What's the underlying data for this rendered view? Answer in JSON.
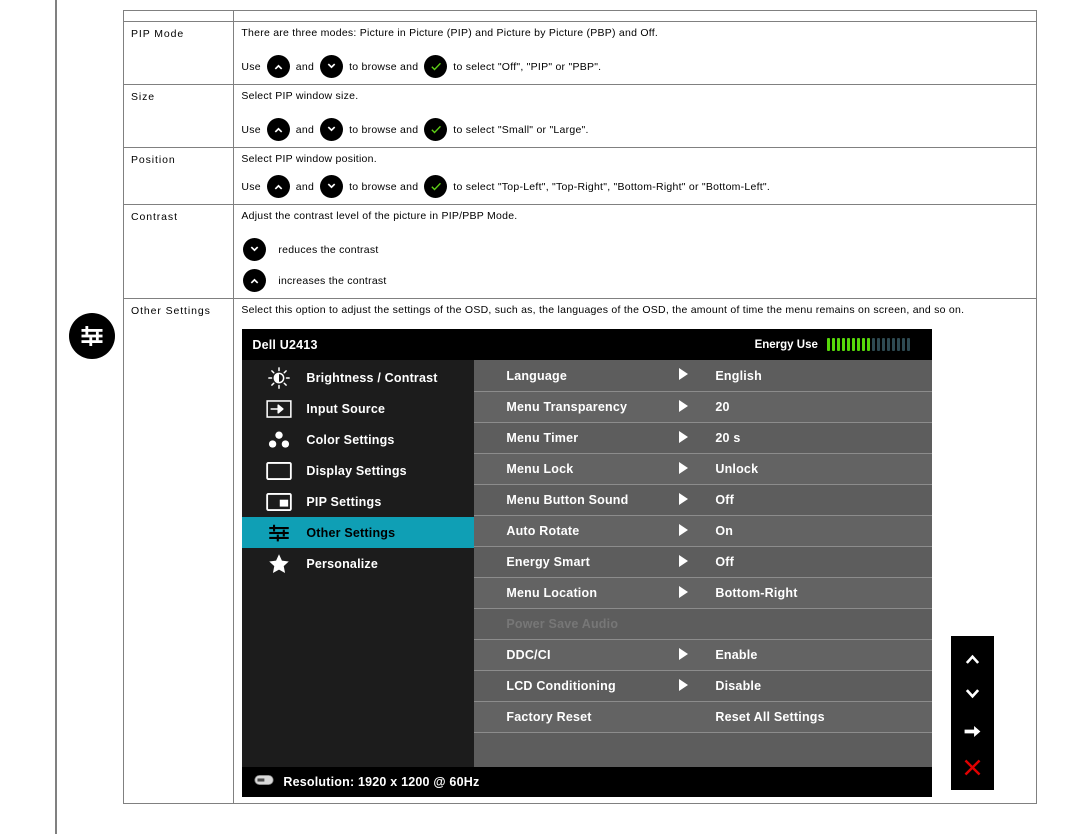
{
  "doc": {
    "rows": [
      {
        "name": "PIP Mode",
        "desc": "There are three modes: Picture in Picture (PIP) and Picture by Picture (PBP) and Off.",
        "keyline": {
          "use": "Use",
          "and": "and",
          "browse": "to browse and",
          "select": "to select \"Off\", \"PIP\" or \"PBP\"."
        }
      },
      {
        "name": "Size",
        "desc": "Select PIP window size.",
        "keyline": {
          "use": "Use",
          "and": "and",
          "browse": "to browse and",
          "select": "to select \"Small\" or \"Large\"."
        }
      },
      {
        "name": "Position",
        "desc": "Select PIP window position.",
        "keyline": {
          "use": "Use",
          "and": "and",
          "browse": "to browse and",
          "select": "to select \"Top-Left\", \"Top-Right\", \"Bottom-Right\" or \"Bottom-Left\"."
        }
      },
      {
        "name": "Contrast",
        "desc": "Adjust the contrast level of the picture in PIP/PBP Mode.",
        "down_text": "reduces the contrast",
        "up_text": "increases the contrast"
      },
      {
        "name": "Other Settings",
        "desc": "Select this option to adjust the settings of the OSD, such as, the languages of the OSD, the amount of time the menu remains on screen, and so on.",
        "section_icon": "sliders-icon"
      }
    ]
  },
  "osd": {
    "model": "Dell U2413",
    "energy": {
      "label": "Energy Use",
      "filled": 9,
      "total": 17
    },
    "sidebar": [
      {
        "label": "Brightness / Contrast",
        "icon": "brightness-icon",
        "selected": false
      },
      {
        "label": "Input Source",
        "icon": "input-source-icon",
        "selected": false
      },
      {
        "label": "Color Settings",
        "icon": "color-settings-icon",
        "selected": false
      },
      {
        "label": "Display Settings",
        "icon": "display-settings-icon",
        "selected": false
      },
      {
        "label": "PIP Settings",
        "icon": "pip-settings-icon",
        "selected": false
      },
      {
        "label": "Other Settings",
        "icon": "sliders-icon",
        "selected": true
      },
      {
        "label": "Personalize",
        "icon": "star-icon",
        "selected": false
      }
    ],
    "options": [
      {
        "label": "Language",
        "value": "English",
        "arrow": true,
        "disabled": false
      },
      {
        "label": "Menu Transparency",
        "value": "20",
        "arrow": true,
        "disabled": false
      },
      {
        "label": "Menu Timer",
        "value": "20 s",
        "arrow": true,
        "disabled": false
      },
      {
        "label": "Menu Lock",
        "value": "Unlock",
        "arrow": true,
        "disabled": false
      },
      {
        "label": "Menu Button Sound",
        "value": "Off",
        "arrow": true,
        "disabled": false
      },
      {
        "label": "Auto Rotate",
        "value": "On",
        "arrow": true,
        "disabled": false
      },
      {
        "label": "Energy Smart",
        "value": "Off",
        "arrow": true,
        "disabled": false
      },
      {
        "label": "Menu Location",
        "value": "Bottom-Right",
        "arrow": true,
        "disabled": false
      },
      {
        "label": "Power Save Audio",
        "value": "",
        "arrow": false,
        "disabled": true
      },
      {
        "label": "DDC/CI",
        "value": "Enable",
        "arrow": true,
        "disabled": false
      },
      {
        "label": "LCD Conditioning",
        "value": "Disable",
        "arrow": true,
        "disabled": false
      },
      {
        "label": "Factory Reset",
        "value": "Reset All Settings",
        "arrow": false,
        "disabled": false
      },
      {
        "label": "",
        "value": "",
        "arrow": false,
        "disabled": false
      }
    ],
    "footer": {
      "resolution": "Resolution: 1920 x 1200 @ 60Hz"
    },
    "buttons": [
      {
        "name": "up-chevron-icon"
      },
      {
        "name": "down-chevron-icon"
      },
      {
        "name": "right-arrow-icon"
      },
      {
        "name": "close-x-icon"
      }
    ],
    "colors": {
      "highlight": "#0f9fb5",
      "energy_on": "#57d80a",
      "energy_off": "#2e4a52",
      "row": "#5d5d5d",
      "row_alt": "#636363",
      "close": "#e00000"
    }
  }
}
